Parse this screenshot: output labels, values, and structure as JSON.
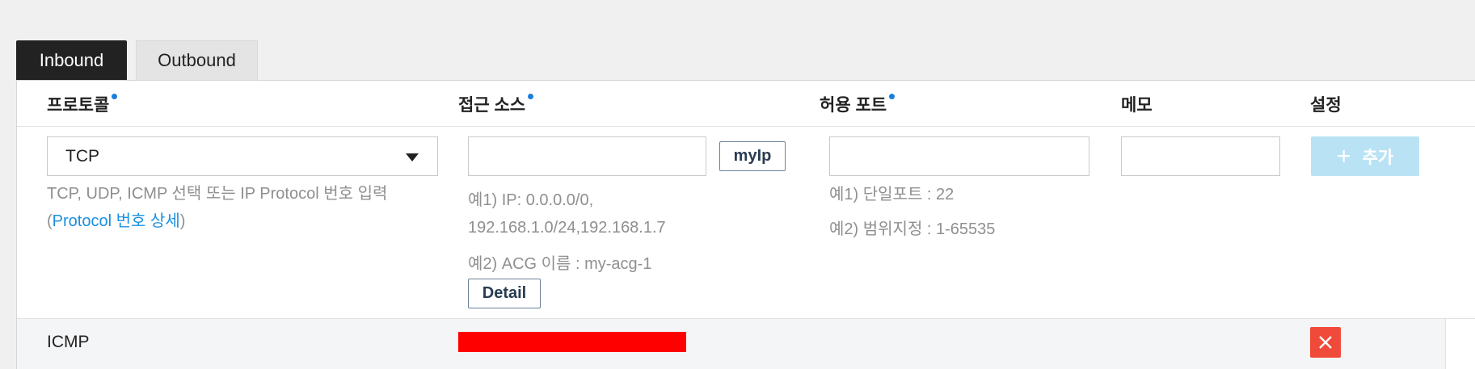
{
  "tabs": [
    {
      "label": "Inbound",
      "active": true
    },
    {
      "label": "Outbound",
      "active": false
    }
  ],
  "headers": {
    "protocol": "프로토콜",
    "source": "접근 소스",
    "port": "허용 포트",
    "memo": "메모",
    "settings": "설정"
  },
  "form": {
    "protocol_value": "TCP",
    "protocol_hint": "TCP, UDP, ICMP 선택 또는 IP Protocol 번호 입력",
    "protocol_hint_open": "(",
    "protocol_link": "Protocol 번호 상세",
    "protocol_hint_close": ")",
    "source_value": "",
    "myip_label": "myIp",
    "source_example1_line1": "예1) IP: 0.0.0.0/0,",
    "source_example1_line2": "192.168.1.0/24,192.168.1.7",
    "source_example2": "예2) ACG 이름 : my-acg-1",
    "detail_label": "Detail",
    "port_value": "",
    "port_example1": "예1) 단일포트 : 22",
    "port_example2": "예2) 범위지정 : 1-65535",
    "memo_value": "",
    "add_label": "추가"
  },
  "rules": [
    {
      "protocol": "ICMP",
      "source": "[redacted]",
      "port": "",
      "memo": ""
    }
  ],
  "colors": {
    "accent": "#1a7fd6",
    "add_button": "#b9e3f5",
    "delete_button": "#f04a3a",
    "redaction": "#ff0000"
  }
}
